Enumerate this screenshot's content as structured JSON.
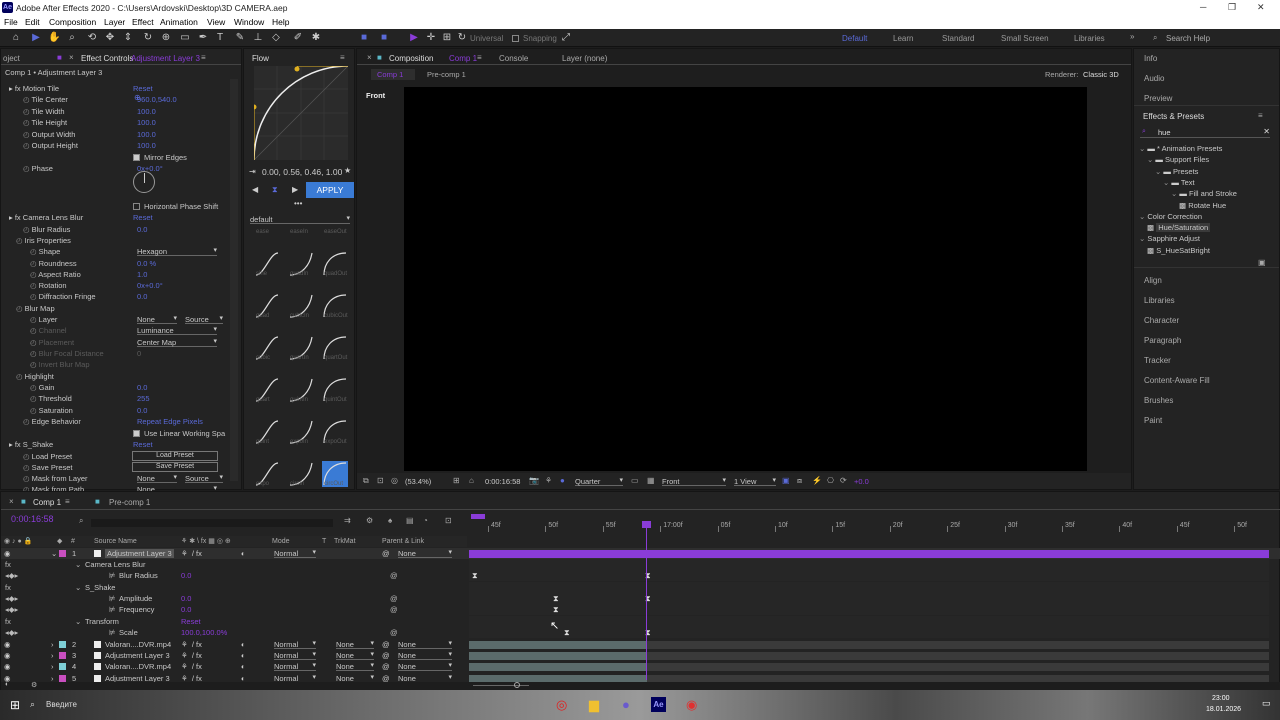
{
  "window": {
    "title": "Adobe After Effects 2020 - C:\\Users\\Ardovski\\Desktop\\3D CAMERA.aep",
    "app_icon": "Ae"
  },
  "menu": [
    "File",
    "Edit",
    "Composition",
    "Layer",
    "Effect",
    "Animation",
    "View",
    "Window",
    "Help"
  ],
  "toolbar": {
    "universal": "Universal",
    "snapping": "Snapping",
    "workspaces": [
      "Learn",
      "Standard",
      "Small Screen",
      "Libraries"
    ],
    "default_ws": "Default",
    "search_help": "Search Help"
  },
  "effect_controls": {
    "tab_left": "oject",
    "tab": "Effect Controls",
    "tab_sub": "Adjustment Layer 3",
    "header": "Comp 1 • Adjustment Layer 3",
    "rows": [
      {
        "label": "Motion Tile",
        "kind": "fx",
        "val": "Reset"
      },
      {
        "label": "Tile Center",
        "val": "960.0,540.0"
      },
      {
        "label": "Tile Width",
        "val": "100.0"
      },
      {
        "label": "Tile Height",
        "val": "100.0"
      },
      {
        "label": "Output Width",
        "val": "100.0"
      },
      {
        "label": "Output Height",
        "val": "100.0"
      },
      {
        "label": "",
        "val": "Mirror Edges"
      },
      {
        "label": "Phase",
        "val": "0x+0.0°"
      },
      {
        "label": "",
        "val": "Horizontal Phase Shift"
      },
      {
        "label": "Camera Lens Blur",
        "kind": "fx",
        "val": "Reset"
      },
      {
        "label": "Blur Radius",
        "val": "0.0"
      },
      {
        "label": "Iris Properties",
        "val": ""
      },
      {
        "label": "Shape",
        "val": "Hexagon"
      },
      {
        "label": "Roundness",
        "val": "0.0 %"
      },
      {
        "label": "Aspect Ratio",
        "val": "1.0"
      },
      {
        "label": "Rotation",
        "val": "0x+0.0°"
      },
      {
        "label": "Diffraction Fringe",
        "val": "0.0"
      },
      {
        "label": "Blur Map",
        "val": ""
      },
      {
        "label": "Layer",
        "val": "None"
      },
      {
        "label": "Channel",
        "val": "Luminance"
      },
      {
        "label": "Placement",
        "val": "Center Map"
      },
      {
        "label": "Blur Focal Distance",
        "val": "0"
      },
      {
        "label": "Invert Blur Map",
        "val": ""
      },
      {
        "label": "Highlight",
        "val": ""
      },
      {
        "label": "Gain",
        "val": "0.0"
      },
      {
        "label": "Threshold",
        "val": "255"
      },
      {
        "label": "Saturation",
        "val": "0.0"
      },
      {
        "label": "Edge Behavior",
        "val": "Repeat Edge Pixels"
      },
      {
        "label": "",
        "val": "Use Linear Working Spa"
      },
      {
        "label": "S_Shake",
        "kind": "fx",
        "val": "Reset"
      },
      {
        "label": "Load Preset",
        "val": "Load Preset"
      },
      {
        "label": "Save Preset",
        "val": "Save Preset"
      },
      {
        "label": "Mask from Layer",
        "val": "None"
      },
      {
        "label": "Mask from Path",
        "val": "None"
      }
    ],
    "source_dd": "Source"
  },
  "flow": {
    "tab": "Flow",
    "values": "0.00, 0.56, 0.46, 1.00",
    "apply": "APPLY",
    "preset": "default",
    "rows": [
      [
        "ease",
        "easeIn",
        "easeOut"
      ],
      [
        "sine",
        "quadIn",
        "quadOut"
      ],
      [
        "quad",
        "cubicIn",
        "cubicOut"
      ],
      [
        "cubic",
        "quartIn",
        "quartOut"
      ],
      [
        "quart",
        "quintIn",
        "quintOut"
      ],
      [
        "quint",
        "expoIn",
        "expoOut"
      ],
      [
        "expo",
        "circIn",
        "circOut"
      ]
    ]
  },
  "composition": {
    "tab": "Composition",
    "tab_sub": "Comp 1",
    "console": "Console",
    "layer_tab": "Layer (none)",
    "crumb1": "Comp 1",
    "crumb2": "Pre-comp 1",
    "renderer_label": "Renderer:",
    "renderer": "Classic 3D",
    "view_label": "Front",
    "bottom": {
      "zoom": "(53.4%)",
      "time": "0:00:16:58",
      "res": "Quarter",
      "view": "Front",
      "views": "1 View",
      "exposure": "+0.0"
    }
  },
  "right_panel": {
    "items_top": [
      "Info",
      "Audio",
      "Preview"
    ],
    "fx_title": "Effects & Presets",
    "search": "hue",
    "tree": [
      {
        "t": "* Animation Presets",
        "lvl": 0,
        "k": "folder"
      },
      {
        "t": "Support Files",
        "lvl": 1,
        "k": "folder"
      },
      {
        "t": "Presets",
        "lvl": 2,
        "k": "folder"
      },
      {
        "t": "Text",
        "lvl": 3,
        "k": "folder"
      },
      {
        "t": "Fill and Stroke",
        "lvl": 4,
        "k": "folder"
      },
      {
        "t": "Rotate Hue",
        "lvl": 5,
        "k": "file"
      },
      {
        "t": "Color Correction",
        "lvl": 0,
        "k": "cat"
      },
      {
        "t": "Hue/Saturation",
        "lvl": 1,
        "k": "file",
        "sel": true
      },
      {
        "t": "Sapphire Adjust",
        "lvl": 0,
        "k": "cat"
      },
      {
        "t": "S_HueSatBright",
        "lvl": 1,
        "k": "file"
      }
    ],
    "items_bottom": [
      "Align",
      "Libraries",
      "Character",
      "Paragraph",
      "Tracker",
      "Content-Aware Fill",
      "Brushes",
      "Paint"
    ]
  },
  "timeline": {
    "tabs": [
      "Comp 1",
      "Pre-comp 1"
    ],
    "timecode": "0:00:16:58",
    "ruler": [
      "45f",
      "50f",
      "55f",
      "17:00f",
      "05f",
      "10f",
      "15f",
      "20f",
      "25f",
      "30f",
      "35f",
      "40f",
      "45f",
      "50f"
    ],
    "headers": {
      "source": "Source Name",
      "parent": "Parent & Link",
      "mode": "Mode",
      "t": "T",
      "trkmat": "TrkMat",
      "num": "#"
    },
    "layers": [
      {
        "num": "1",
        "name": "Adjustment Layer 3",
        "mode": "Normal",
        "trk": "",
        "parent": "None",
        "type": "layer",
        "sel": true
      },
      {
        "name": "Camera Lens Blur",
        "type": "group"
      },
      {
        "name": "Blur Radius",
        "val": "0.0",
        "type": "prop"
      },
      {
        "name": "S_Shake",
        "type": "group"
      },
      {
        "name": "Amplitude",
        "val": "0.0",
        "type": "prop"
      },
      {
        "name": "Frequency",
        "val": "0.0",
        "type": "prop"
      },
      {
        "name": "Transform",
        "val": "Reset",
        "type": "group"
      },
      {
        "name": "Scale",
        "val": "100.0,100.0%",
        "type": "prop"
      },
      {
        "num": "2",
        "name": "Valoran....DVR.mp4",
        "mode": "Normal",
        "trk": "None",
        "parent": "None",
        "type": "layer",
        "color": "#7ecfd6"
      },
      {
        "num": "3",
        "name": "Adjustment Layer 3",
        "mode": "Normal",
        "trk": "None",
        "parent": "None",
        "type": "layer",
        "color": "#c94fc0"
      },
      {
        "num": "4",
        "name": "Valoran....DVR.mp4",
        "mode": "Normal",
        "trk": "None",
        "parent": "None",
        "type": "layer",
        "color": "#7ecfd6"
      },
      {
        "num": "5",
        "name": "Adjustment Layer 3",
        "mode": "Normal",
        "trk": "None",
        "parent": "None",
        "type": "layer",
        "color": "#c94fc0"
      }
    ]
  },
  "taskbar": {
    "search": "Введите",
    "time": "23:00",
    "date": "18.01.2026"
  },
  "colors": {
    "accent": "#8a3cd8",
    "blue": "#5a6ad8",
    "apply": "#3a7bd5"
  }
}
